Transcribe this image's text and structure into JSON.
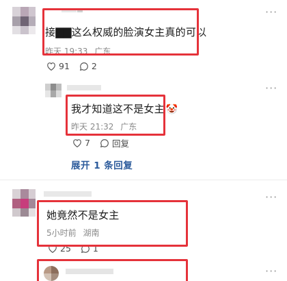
{
  "comments": [
    {
      "text": "接▇▇这么权威的脸演女主真的可以",
      "time": "昨天 19:33",
      "location": "广东",
      "likes": "91",
      "replies": "2"
    },
    {
      "text": "我才知道这不是女主",
      "emoji": "🤡",
      "time": "昨天 21:32",
      "location": "广东",
      "likes": "7",
      "reply_label": "回复"
    },
    {
      "text": "她竟然不是女主",
      "time": "5小时前",
      "location": "湖南",
      "likes": "25",
      "replies": "1"
    }
  ],
  "expand_label": "展开 1 条回复",
  "more_glyph": "···",
  "colors": {
    "highlight": "#e5323a",
    "link": "#2b5a9b",
    "meta": "#8a8a8a"
  }
}
